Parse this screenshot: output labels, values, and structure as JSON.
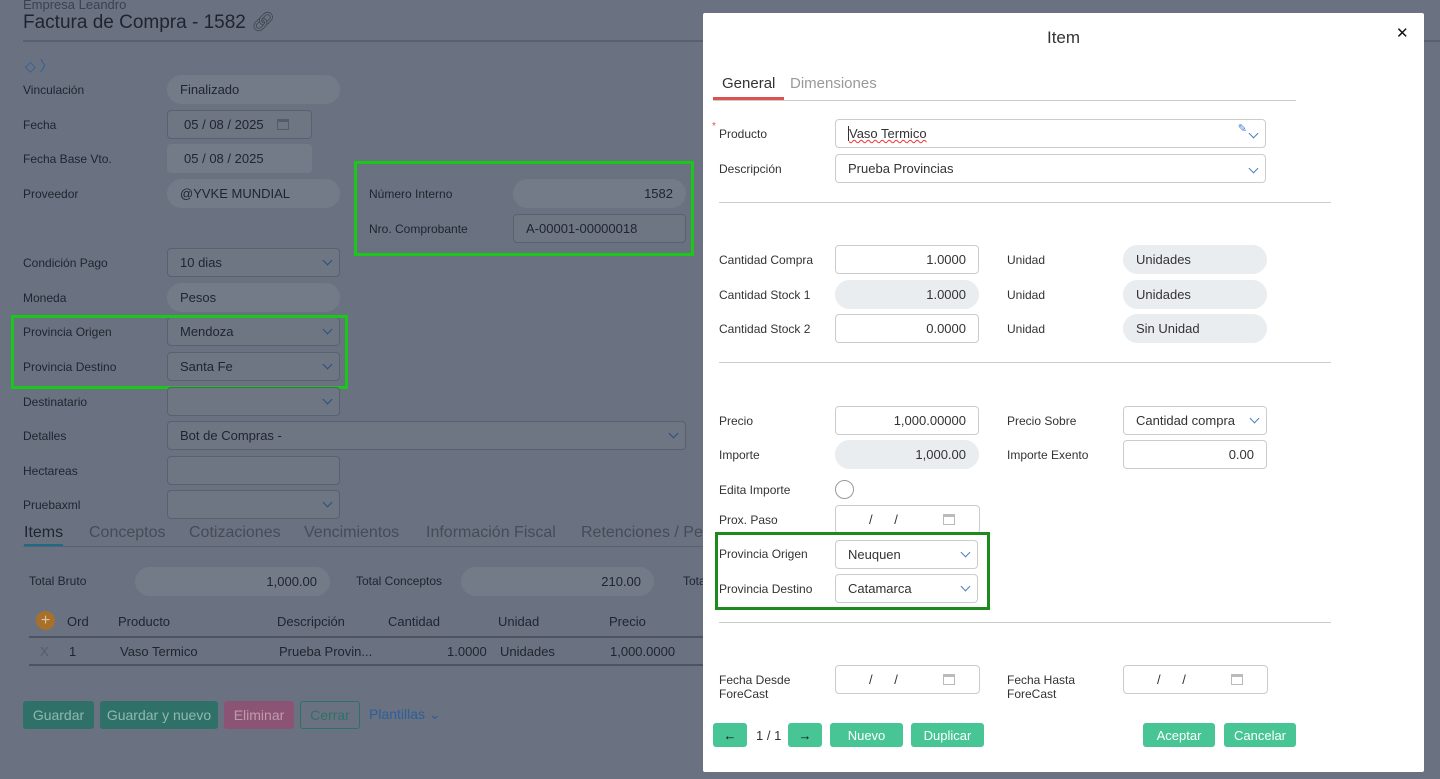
{
  "header": {
    "company": "Empresa Leandro",
    "title": "Factura de Compra - 1582"
  },
  "form": {
    "vinculacion": {
      "label": "Vinculación",
      "value": "Finalizado"
    },
    "fecha": {
      "label": "Fecha",
      "d": "05",
      "m": "08",
      "y": "2025"
    },
    "fecha_base": {
      "label": "Fecha Base Vto.",
      "d": "05",
      "m": "08",
      "y": "2025"
    },
    "proveedor": {
      "label": "Proveedor",
      "value": "@YVKE MUNDIAL"
    },
    "numero_interno": {
      "label": "Número Interno",
      "value": "1582"
    },
    "nro_comprobante": {
      "label": "Nro. Comprobante",
      "value": "A-00001-00000018"
    },
    "condicion_pago": {
      "label": "Condición Pago",
      "value": "10 dias"
    },
    "moneda": {
      "label": "Moneda",
      "value": "Pesos"
    },
    "provincia_origen": {
      "label": "Provincia Origen",
      "value": "Mendoza"
    },
    "provincia_destino": {
      "label": "Provincia Destino",
      "value": "Santa Fe"
    },
    "destinatario": {
      "label": "Destinatario",
      "value": ""
    },
    "detalles": {
      "label": "Detalles",
      "value": "Bot de Compras -"
    },
    "hectareas": {
      "label": "Hectareas",
      "value": ""
    },
    "pruebaxml": {
      "label": "Pruebaxml",
      "value": ""
    }
  },
  "tabs": [
    "Items",
    "Conceptos",
    "Cotizaciones",
    "Vencimientos",
    "Información Fiscal",
    "Retenciones / Pe"
  ],
  "totals": {
    "bruto_label": "Total Bruto",
    "bruto": "1,000.00",
    "conceptos_label": "Total Conceptos",
    "conceptos": "210.00",
    "total_label": "Tota"
  },
  "table": {
    "headers": [
      "Ord",
      "Producto",
      "Descripción",
      "Cantidad",
      "Unidad",
      "Precio"
    ],
    "rows": [
      {
        "del": "X",
        "ord": "1",
        "producto": "Vaso Termico",
        "descripcion": "Prueba Provin...",
        "cantidad": "1.0000",
        "unidad": "Unidades",
        "precio": "1,000.0000"
      }
    ]
  },
  "actions": {
    "guardar": "Guardar",
    "guardar_nuevo": "Guardar y nuevo",
    "eliminar": "Eliminar",
    "cerrar": "Cerrar",
    "plantillas": "Plantillas"
  },
  "modal": {
    "title": "Item",
    "close": "✕",
    "tabs": [
      "General",
      "Dimensiones"
    ],
    "producto": {
      "label": "Producto",
      "value": "Vaso Termico"
    },
    "descripcion": {
      "label": "Descripción",
      "value": "Prueba Provincias"
    },
    "cantidad_compra": {
      "label": "Cantidad Compra",
      "value": "1.0000",
      "unit_label": "Unidad",
      "unit": "Unidades"
    },
    "cantidad_stock1": {
      "label": "Cantidad Stock 1",
      "value": "1.0000",
      "unit_label": "Unidad",
      "unit": "Unidades"
    },
    "cantidad_stock2": {
      "label": "Cantidad Stock 2",
      "value": "0.0000",
      "unit_label": "Unidad",
      "unit": "Sin Unidad"
    },
    "precio": {
      "label": "Precio",
      "value": "1,000.00000"
    },
    "precio_sobre": {
      "label": "Precio Sobre",
      "value": "Cantidad compra"
    },
    "importe": {
      "label": "Importe",
      "value": "1,000.00"
    },
    "importe_exento": {
      "label": "Importe Exento",
      "value": "0.00"
    },
    "edita_importe": {
      "label": "Edita Importe"
    },
    "prox_paso": {
      "label": "Prox. Paso"
    },
    "provincia_origen": {
      "label": "Provincia Origen",
      "value": "Neuquen"
    },
    "provincia_destino": {
      "label": "Provincia Destino",
      "value": "Catamarca"
    },
    "fecha_desde": {
      "label": "Fecha Desde ForeCast"
    },
    "fecha_hasta": {
      "label": "Fecha Hasta ForeCast"
    },
    "pager": "1 / 1",
    "nuevo": "Nuevo",
    "duplicar": "Duplicar",
    "aceptar": "Aceptar",
    "cancelar": "Cancelar"
  }
}
